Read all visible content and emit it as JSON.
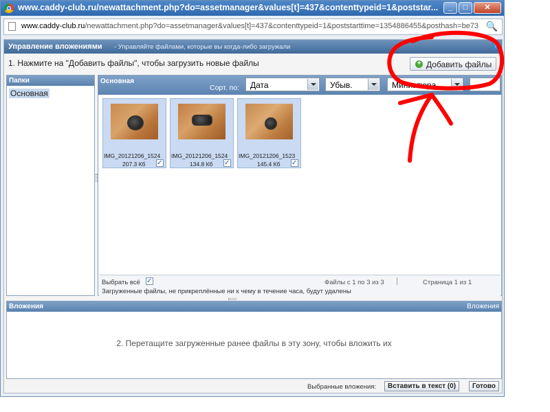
{
  "window": {
    "title": "www.caddy-club.ru/newattachment.php?do=assetmanager&values[t]=437&contenttypeid=1&poststar...",
    "min_glyph": "_",
    "max_glyph": "□",
    "close_glyph": "✕"
  },
  "address": {
    "domain": "www.caddy-club.ru",
    "path": "/newattachment.php?do=assetmanager&values[t]=437&contenttypeid=1&poststarttime=1354886455&posthash=be73",
    "zoom_icon": "🔍"
  },
  "manager": {
    "title": "Управление вложениями",
    "subtitle": "- Управляйте файлами, которые вы когда-либо загружали",
    "help_icon": "?",
    "step1": "1. Нажмите на \"Добавить файлы\", чтобы загрузить новые файлы",
    "add_button": "Добавить файлы",
    "add_icon": "+"
  },
  "folders": {
    "header": "Папки",
    "items": [
      "Основная"
    ]
  },
  "main": {
    "header": "Основная",
    "sort_label": "Сорт. по:",
    "sort_field": "Дата",
    "sort_order": "Убыв.",
    "view_mode": "Миниатюра",
    "files": [
      {
        "name": "IMG_20121206_1524",
        "size": "207.3 Кб",
        "checked": true
      },
      {
        "name": "IMG_20121206_1524",
        "size": "134.8 Кб",
        "checked": true
      },
      {
        "name": "IMG_20121206_1523",
        "size": "145.4 Кб",
        "checked": true
      }
    ],
    "check_glyph": "✓",
    "select_all": "Выбрать всё",
    "files_count": "Файлы с 1 по 3 из 3",
    "pages": "Страница 1 из 1",
    "note": "Загруженные файлы, не прикреплённые ни к чему в течение часа, будут удалены"
  },
  "attachments": {
    "header": "Вложения",
    "header_right": "Вложения",
    "drop_hint": "2. Перетащите загруженные ранее файлы в эту зону, чтобы вложить их",
    "selected_label": "Выбранные вложения:",
    "insert_button": "Вставить в текст (0)",
    "done_button": "Готово"
  },
  "annotation": {
    "color": "#ff0000"
  }
}
